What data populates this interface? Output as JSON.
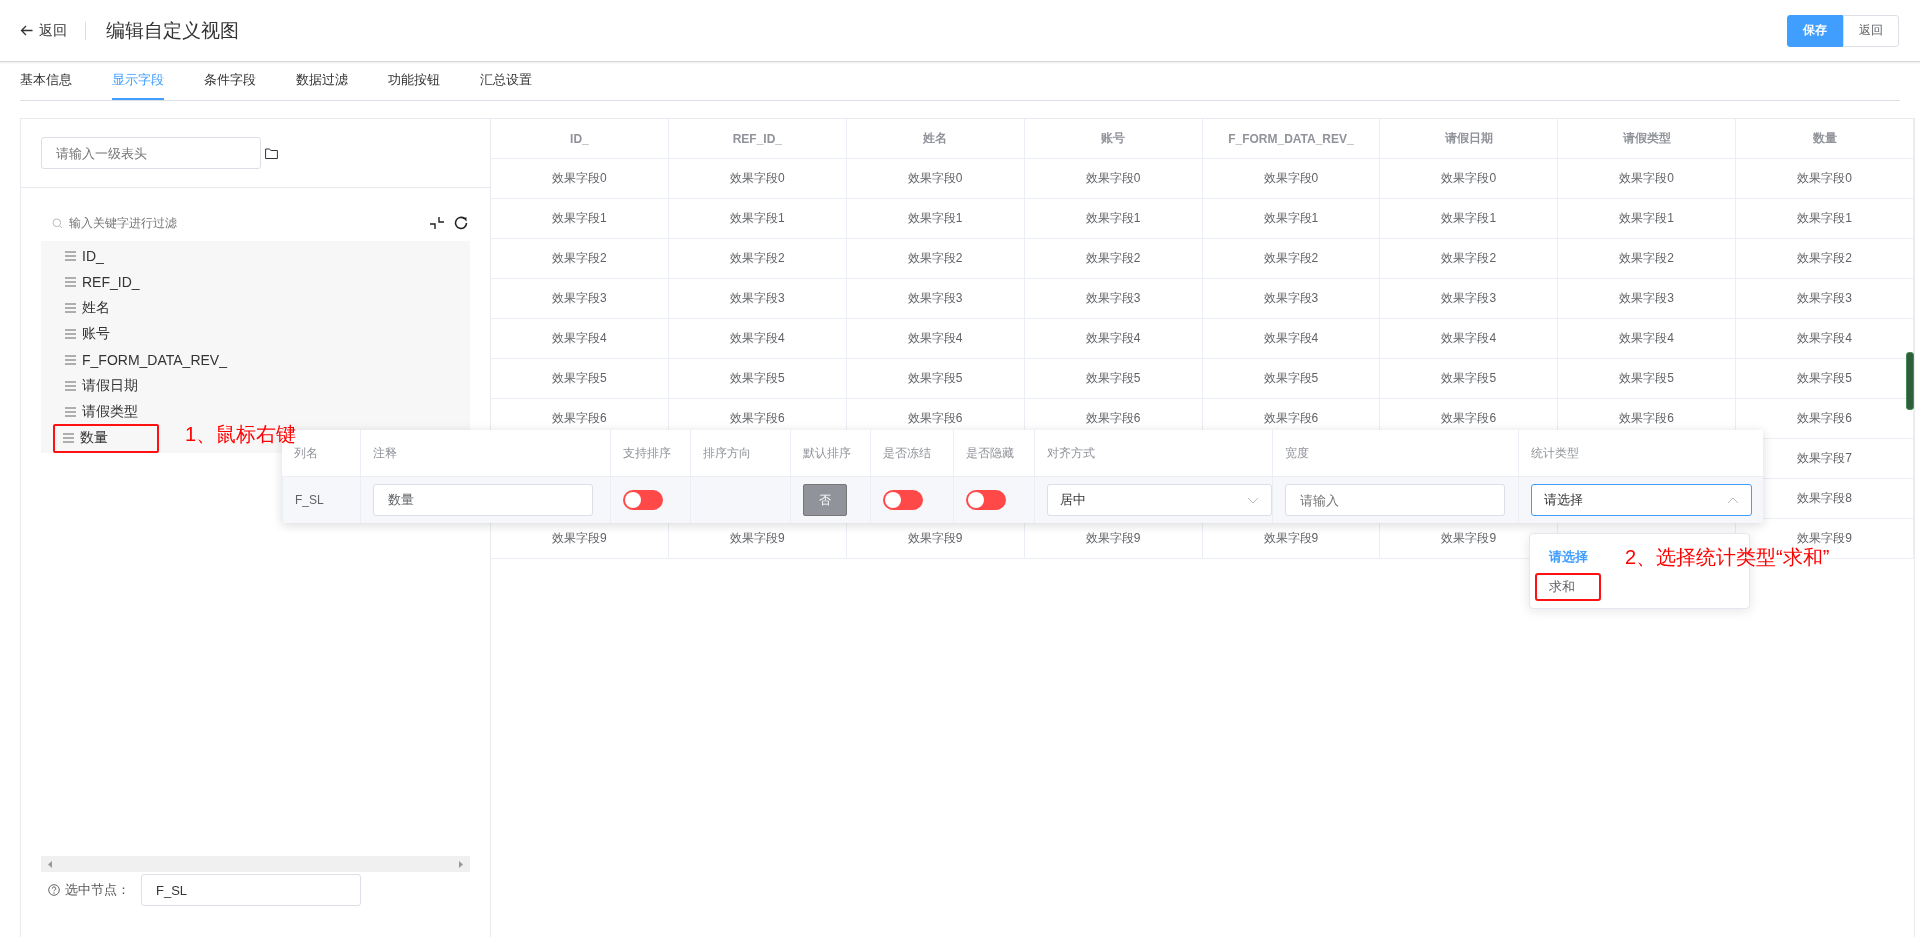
{
  "header": {
    "back": "返回",
    "title": "编辑自定义视图",
    "buttons": [
      {
        "label": "保存",
        "kind": "primary"
      },
      {
        "label": "返回",
        "kind": "default"
      }
    ]
  },
  "tabs": [
    {
      "label": "基本信息",
      "selected": false
    },
    {
      "label": "显示字段",
      "selected": true
    },
    {
      "label": "条件字段",
      "selected": false
    },
    {
      "label": "数据过滤",
      "selected": false
    },
    {
      "label": "功能按钮",
      "selected": false
    },
    {
      "label": "汇总设置",
      "selected": false
    }
  ],
  "left_panel": {
    "header_input": {
      "placeholder": "请输入一级表头"
    },
    "filter": {
      "placeholder": "输入关键字进行过滤"
    },
    "tree": [
      {
        "label": "ID_",
        "marked": false
      },
      {
        "label": "REF_ID_",
        "marked": false
      },
      {
        "label": "姓名",
        "marked": false
      },
      {
        "label": "账号",
        "marked": false
      },
      {
        "label": "F_FORM_DATA_REV_",
        "marked": false
      },
      {
        "label": "请假日期",
        "marked": false
      },
      {
        "label": "请假类型",
        "marked": false
      },
      {
        "label": "数量",
        "marked": true
      }
    ],
    "selected_node": {
      "label": "选中节点：",
      "value": "F_SL"
    }
  },
  "table": {
    "columns": [
      "ID_",
      "REF_ID_",
      "姓名",
      "账号",
      "F_FORM_DATA_REV_",
      "请假日期",
      "请假类型",
      "数量"
    ],
    "rows": [
      [
        "效果字段0",
        "效果字段0",
        "效果字段0",
        "效果字段0",
        "效果字段0",
        "效果字段0",
        "效果字段0",
        "效果字段0"
      ],
      [
        "效果字段1",
        "效果字段1",
        "效果字段1",
        "效果字段1",
        "效果字段1",
        "效果字段1",
        "效果字段1",
        "效果字段1"
      ],
      [
        "效果字段2",
        "效果字段2",
        "效果字段2",
        "效果字段2",
        "效果字段2",
        "效果字段2",
        "效果字段2",
        "效果字段2"
      ],
      [
        "效果字段3",
        "效果字段3",
        "效果字段3",
        "效果字段3",
        "效果字段3",
        "效果字段3",
        "效果字段3",
        "效果字段3"
      ],
      [
        "效果字段4",
        "效果字段4",
        "效果字段4",
        "效果字段4",
        "效果字段4",
        "效果字段4",
        "效果字段4",
        "效果字段4"
      ],
      [
        "效果字段5",
        "效果字段5",
        "效果字段5",
        "效果字段5",
        "效果字段5",
        "效果字段5",
        "效果字段5",
        "效果字段5"
      ],
      [
        "效果字段6",
        "效果字段6",
        "效果字段6",
        "效果字段6",
        "效果字段6",
        "效果字段6",
        "效果字段6",
        "效果字段6"
      ],
      [
        null,
        null,
        null,
        null,
        null,
        null,
        null,
        "效果字段7"
      ],
      [
        null,
        null,
        null,
        null,
        null,
        null,
        null,
        "效果字段8"
      ],
      [
        "效果字段9",
        "效果字段9",
        "效果字段9",
        "效果字段9",
        "效果字段9",
        "效果字段9",
        null,
        "效果字段9"
      ]
    ]
  },
  "column_editor": {
    "columns": [
      "列名",
      "注释",
      "支持排序",
      "排序方向",
      "默认排序",
      "是否冻结",
      "是否隐藏",
      "对齐方式",
      "宽度",
      "统计类型"
    ],
    "row": {
      "name": "F_SL",
      "comment": "数量",
      "sortable": false,
      "default_sort": "否",
      "frozen": false,
      "hidden": false,
      "align": "居中",
      "width_placeholder": "请输入",
      "aggregate": {
        "value": "请选择",
        "open": true
      }
    }
  },
  "dropdown": {
    "options": [
      {
        "label": "请选择",
        "selected": true,
        "marked": false
      },
      {
        "label": "求和",
        "selected": false,
        "marked": true
      }
    ]
  },
  "annotations": [
    {
      "text": "1、鼠标右键"
    },
    {
      "text": "2、选择统计类型“求和”"
    }
  ]
}
